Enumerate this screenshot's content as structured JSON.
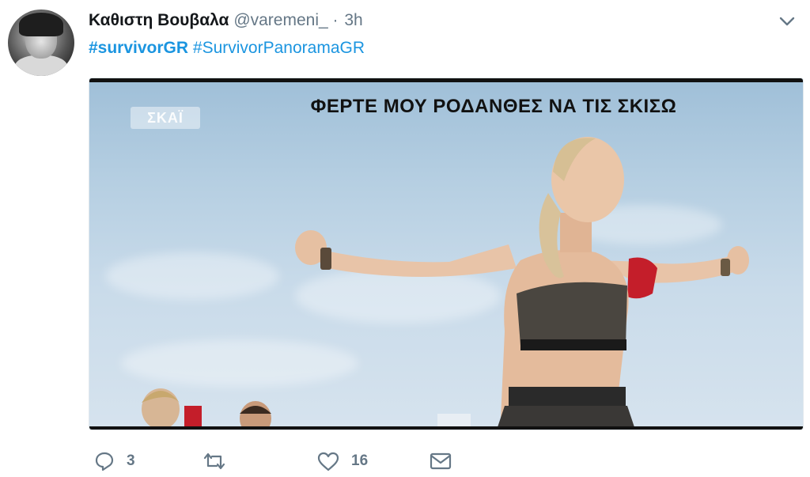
{
  "tweet": {
    "author_name": "Καθιστη Βουβαλα",
    "handle": "@varemeni_",
    "separator": "·",
    "time": "3h",
    "hashtags": [
      "#survivorGR",
      "#SurvivorPanoramaGR"
    ]
  },
  "media": {
    "caption": "ΦΕΡΤΕ ΜΟΥ ΡΟΔΑΝΘΕΣ ΝΑ ΤΙΣ ΣΚΙΣΩ",
    "watermark": "ΣΚΑΪ"
  },
  "actions": {
    "reply_count": "3",
    "retweet_count": "",
    "like_count": "16"
  },
  "icons": {
    "reply": "reply-icon",
    "retweet": "retweet-icon",
    "like": "heart-icon",
    "message": "envelope-icon",
    "menu": "chevron-down-icon"
  },
  "colors": {
    "link": "#1b95e0",
    "muted": "#657786"
  }
}
